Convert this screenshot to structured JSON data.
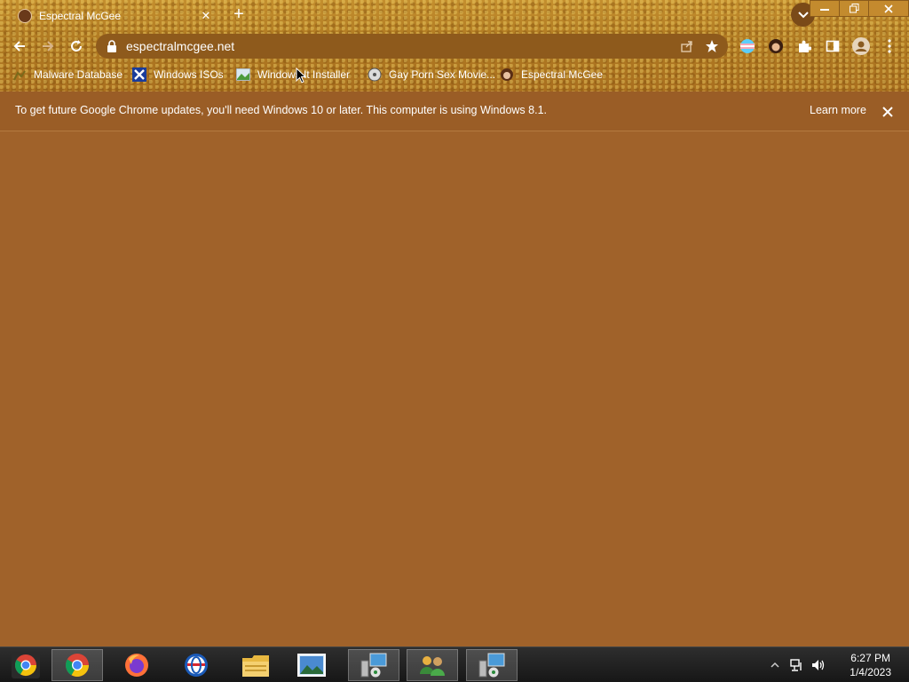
{
  "window": {
    "tab_title": "Espectral McGee",
    "new_tab_symbol": "+",
    "close_tab_symbol": "✕"
  },
  "toolbar": {
    "url": "espectralmcgee.net"
  },
  "bookmarks": [
    {
      "label": "Malware Database",
      "icon": "malware-icon"
    },
    {
      "label": "Windows ISOs",
      "icon": "x-logo-icon"
    },
    {
      "label": "Windows It Installer",
      "icon": "image-icon"
    },
    {
      "label": "Gay Porn Sex Movie...",
      "icon": "cd-icon"
    },
    {
      "label": "Espectral McGee",
      "icon": "avatar-icon"
    }
  ],
  "infobar": {
    "message": "To get future Google Chrome updates, you'll need Windows 10 or later. This computer is using Windows 8.1.",
    "learn_more": "Learn more"
  },
  "taskbar": {
    "apps": [
      "chrome-start-icon",
      "chrome-icon",
      "firefox-icon",
      "opera-icon",
      "file-explorer-icon",
      "photos-icon",
      "network-setup-icon",
      "users-icon",
      "network-setup-icon"
    ],
    "time": "6:27 PM",
    "date": "1/4/2023"
  },
  "colors": {
    "page_bg": "#a0622a",
    "frame": "#b07a22",
    "taskbar": "#1e1e1e"
  }
}
